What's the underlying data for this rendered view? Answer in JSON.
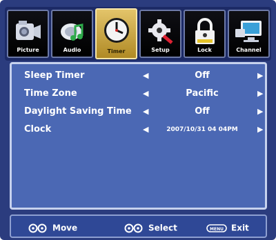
{
  "tabs": [
    {
      "label": "Picture",
      "icon": "camera-icon",
      "active": false
    },
    {
      "label": "Audio",
      "icon": "audio-icon",
      "active": false
    },
    {
      "label": "Timer",
      "icon": "clock-icon",
      "active": true
    },
    {
      "label": "Setup",
      "icon": "gear-icon",
      "active": false
    },
    {
      "label": "Lock",
      "icon": "lock-icon",
      "active": false
    },
    {
      "label": "Channel",
      "icon": "monitor-icon",
      "active": false
    }
  ],
  "menu": {
    "rows": [
      {
        "label": "Sleep Timer",
        "value": "Off"
      },
      {
        "label": "Time Zone",
        "value": "Pacific"
      },
      {
        "label": "Daylight Saving Time",
        "value": "Off"
      },
      {
        "label": "Clock",
        "value": "2007/10/31 04 04PM"
      }
    ]
  },
  "help": {
    "move": "Move",
    "select": "Select",
    "exit": "Exit",
    "menu_key": "MENU"
  },
  "colors": {
    "frame": "#2b3c7e",
    "panel": "#4b68b4",
    "active_tab": "#d4b044"
  }
}
